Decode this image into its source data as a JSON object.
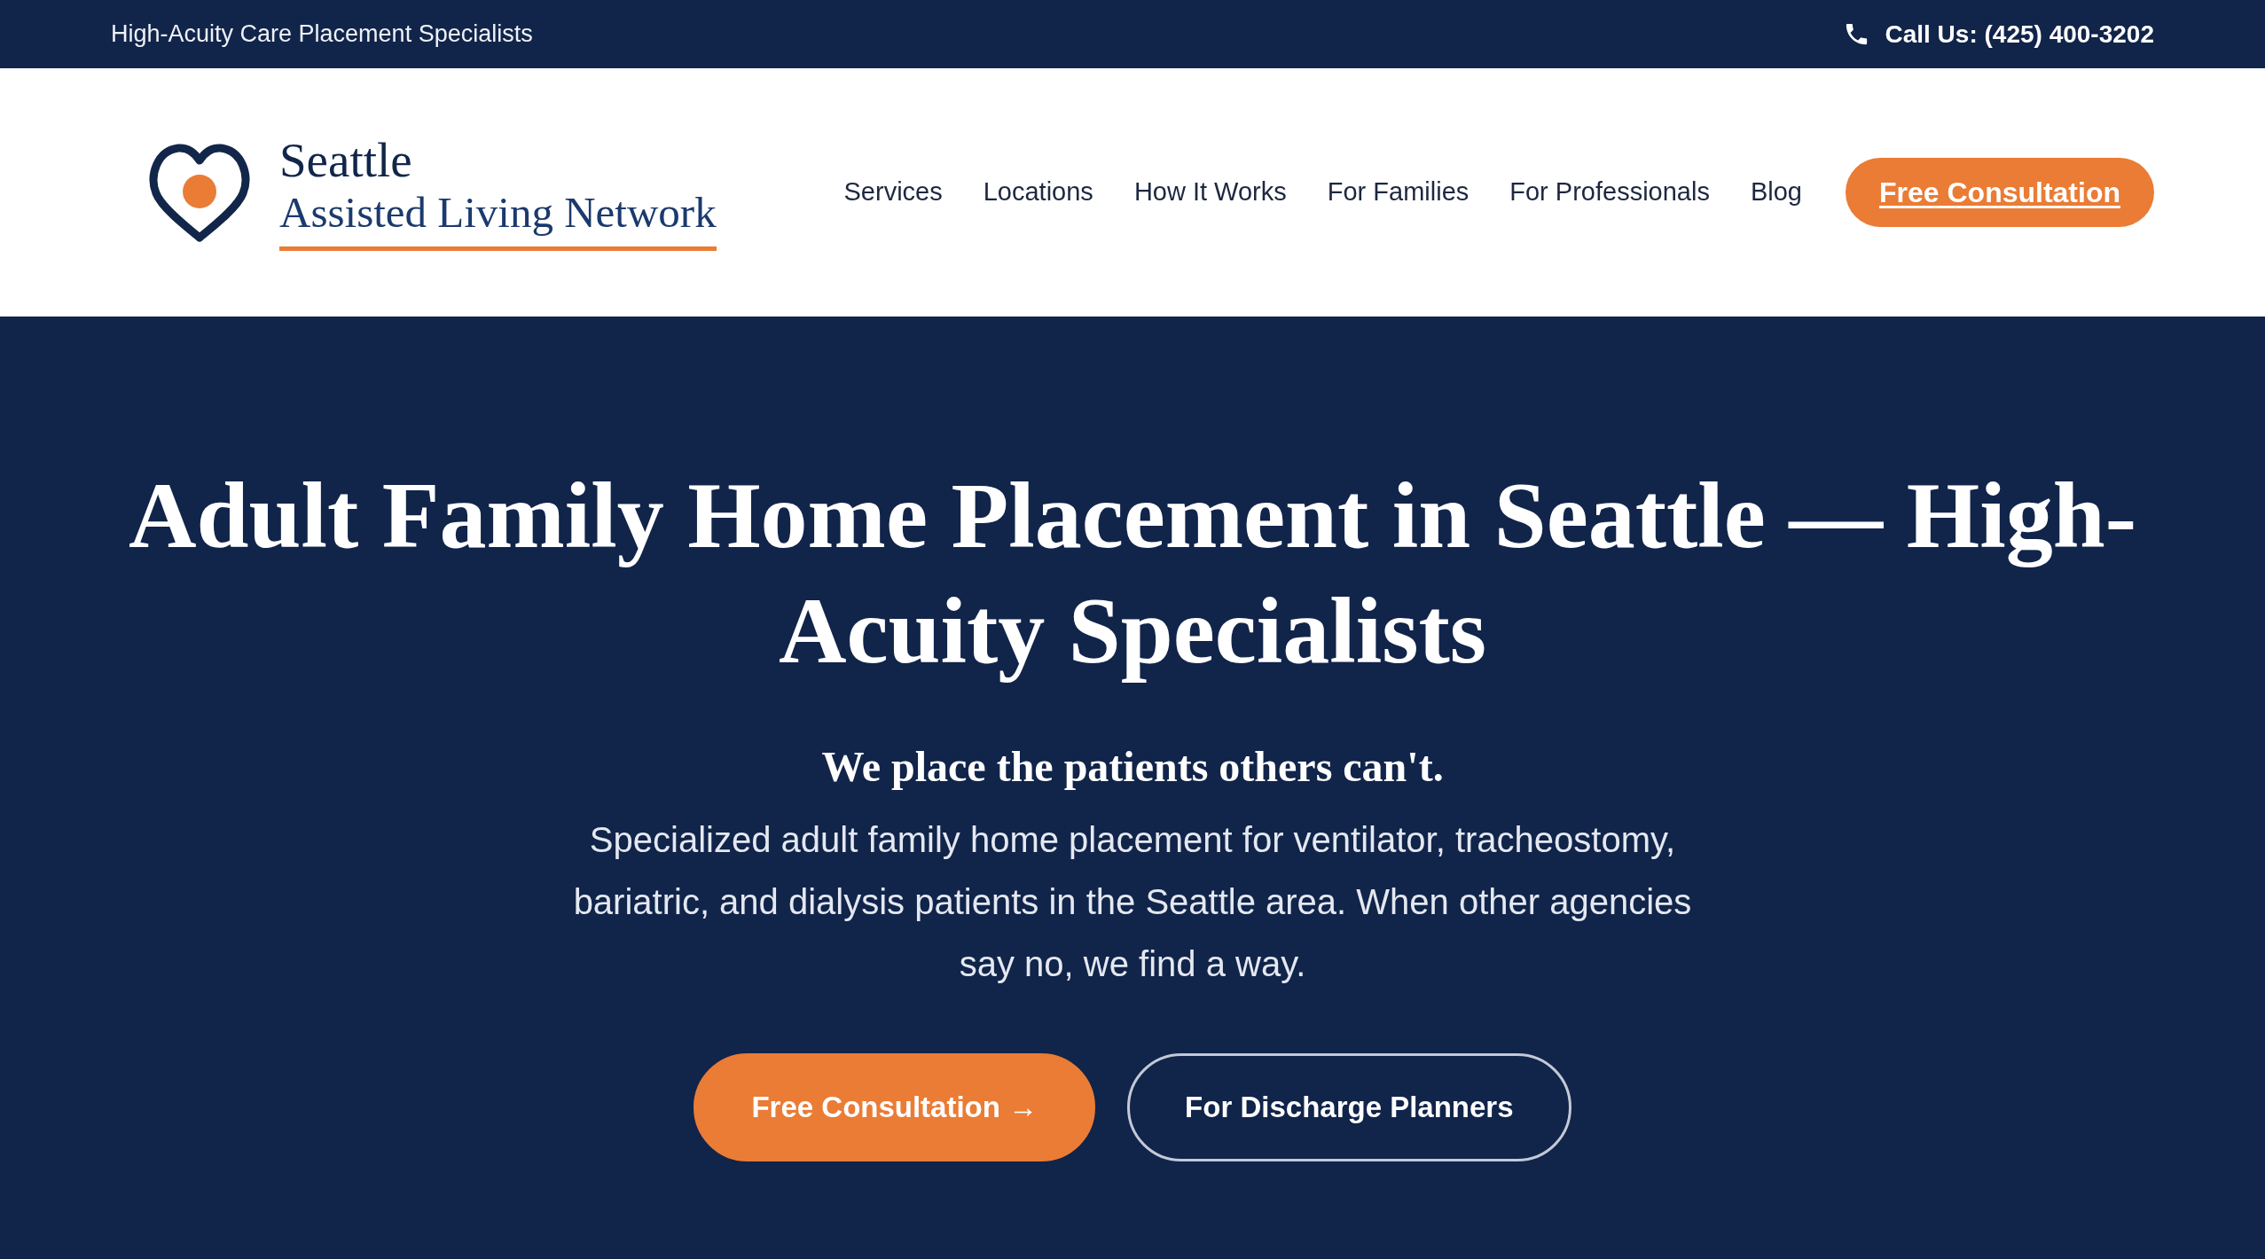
{
  "top_bar": {
    "tagline": "High-Acuity Care Placement Specialists",
    "phone": "Call Us: (425) 400-3202"
  },
  "header": {
    "logo": {
      "title": "Seattle",
      "subtitle": "Assisted Living Network"
    },
    "nav": [
      "Services",
      "Locations",
      "How It Works",
      "For Families",
      "For Professionals",
      "Blog"
    ],
    "cta": "Free Consultation"
  },
  "hero": {
    "title": "Adult Family Home Placement in Seattle — High-Acuity Specialists",
    "tagline": "We place the patients others can't.",
    "description": "Specialized adult family home placement for ventilator, tracheostomy, bariatric, and dialysis patients in the Seattle area. When other agencies say no, we find a way.",
    "buttons": [
      {
        "label": "Free Consultation →",
        "kind": "primary"
      },
      {
        "label": "For Discharge Planners",
        "kind": "outline"
      }
    ]
  }
}
